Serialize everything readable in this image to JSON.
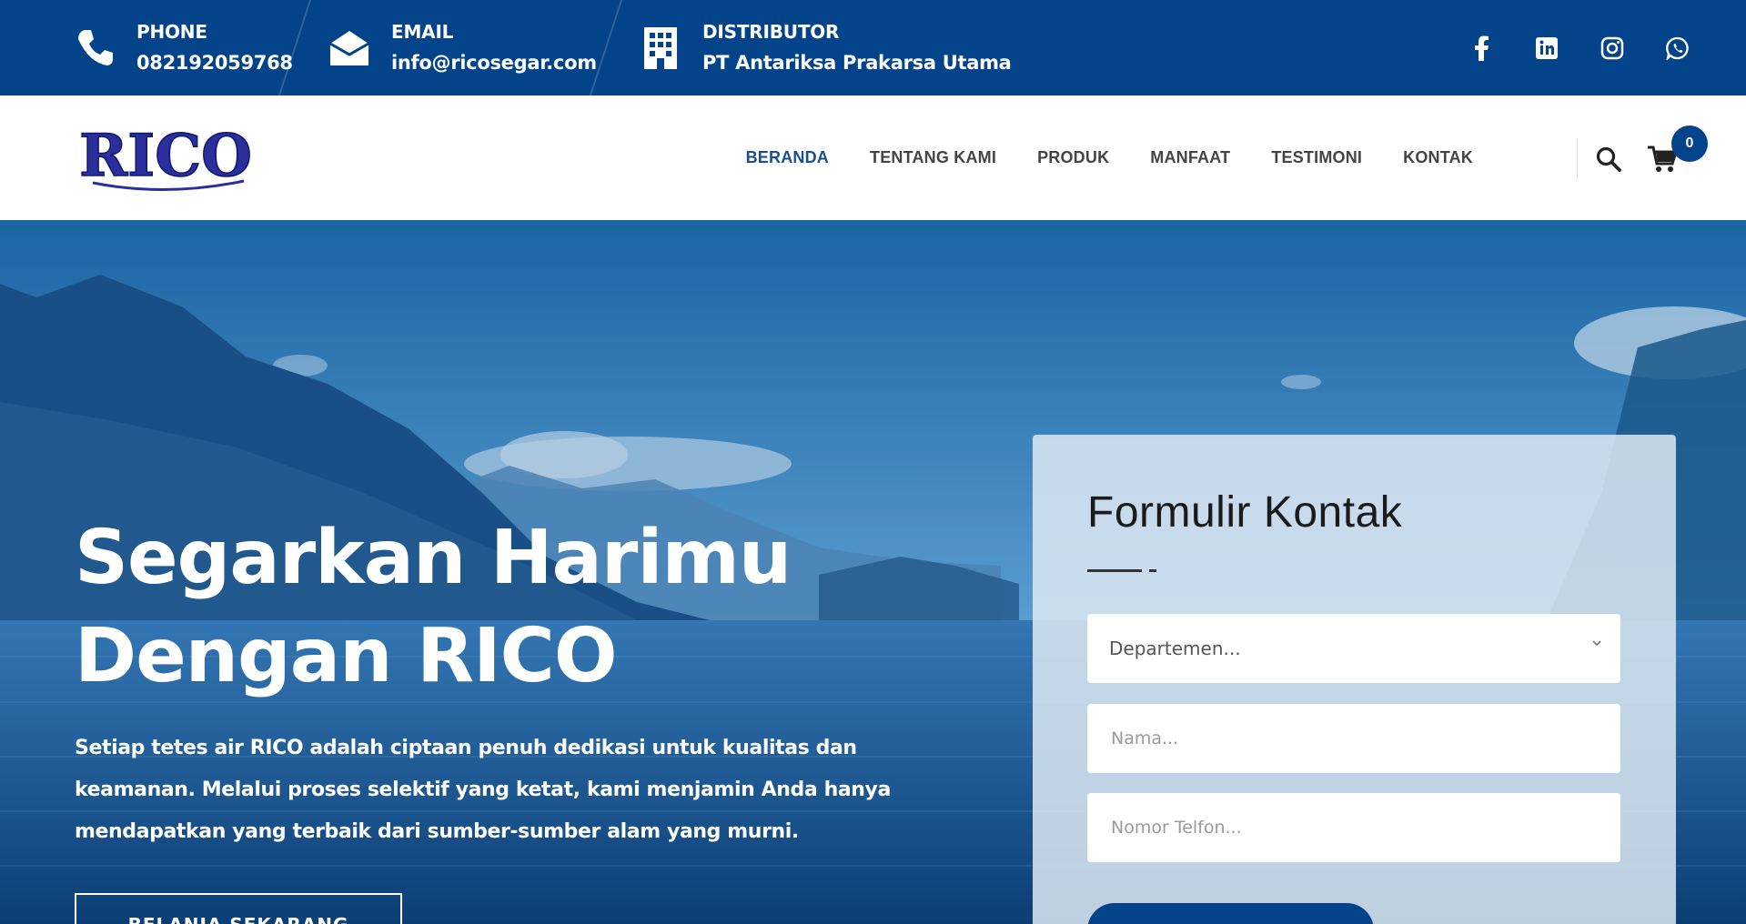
{
  "topbar": {
    "phone": {
      "label": "PHONE",
      "value": "082192059768",
      "icon": "phone-icon"
    },
    "email": {
      "label": "EMAIL",
      "value": "info@ricosegar.com",
      "icon": "envelope-icon"
    },
    "distributor": {
      "label": "DISTRIBUTOR",
      "value": "PT Antariksa Prakarsa Utama",
      "icon": "building-icon"
    },
    "socials": [
      "facebook-icon",
      "linkedin-icon",
      "instagram-icon",
      "whatsapp-icon"
    ]
  },
  "nav": {
    "logo_text": "RICO",
    "links": [
      "BERANDA",
      "TENTANG KAMI",
      "PRODUK",
      "MANFAAT",
      "TESTIMONI",
      "KONTAK"
    ],
    "active_index": 0,
    "cart_count": "0"
  },
  "hero": {
    "title_line1": "Segarkan Harimu",
    "title_line2": "Dengan RICO",
    "description": "Setiap tetes air RICO adalah ciptaan penuh dedikasi untuk kualitas dan keamanan. Melalui proses selektif yang ketat, kami menjamin Anda hanya mendapatkan yang terbaik dari sumber-sumber alam yang murni.",
    "cta": "BELANJA SEKARANG"
  },
  "form": {
    "title": "Formulir Kontak",
    "department_placeholder": "Departemen...",
    "name_placeholder": "Nama...",
    "phone_placeholder": "Nomor Telfon..."
  },
  "colors": {
    "brand": "#034389",
    "accent": "#1b4f8a",
    "white": "#ffffff"
  }
}
